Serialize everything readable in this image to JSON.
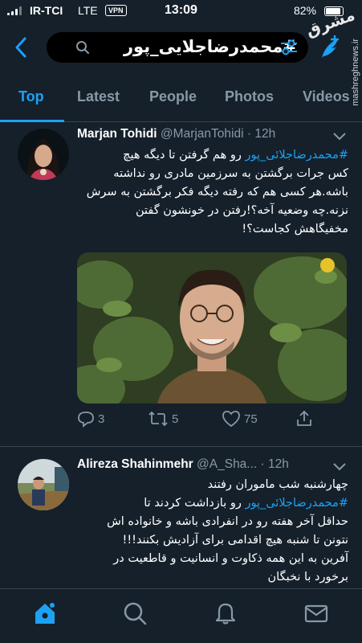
{
  "status_bar": {
    "carrier": "IR-TCI",
    "network": "LTE",
    "vpn": "VPN",
    "time": "13:09",
    "battery": "82%",
    "battery_level": 0.82
  },
  "watermark": {
    "logo": "مشرق",
    "text": "mashreghnews.ir"
  },
  "search": {
    "query": "#محمدرضاجلایی_پور"
  },
  "tabs": [
    {
      "label": "Top",
      "active": true
    },
    {
      "label": "Latest",
      "active": false
    },
    {
      "label": "People",
      "active": false
    },
    {
      "label": "Photos",
      "active": false
    },
    {
      "label": "Videos",
      "active": false
    }
  ],
  "tweets": [
    {
      "name": "Marjan Tohidi",
      "handle": "@MarjanTohidi",
      "time": "· 12h",
      "lines": [
        {
          "hashtag": "#محمدرضاجلائی_پور",
          "text": " رو هم گرفتن تا دیگه هیچ"
        },
        {
          "text": "کس جرات برگشتن به سرزمین مادری رو نداشته"
        },
        {
          "text": "باشه.هر کسی هم که رفته دیگه فکر برگشتن به سرش"
        },
        {
          "text": "نزنه.چه وضعیه آخه؟!رفتن در خونشون گفتن"
        },
        {
          "text": "مخفیگاهش کجاست؟!"
        }
      ],
      "replies": "3",
      "retweets": "5",
      "likes": "75"
    },
    {
      "name": "Alireza Shahinmehr",
      "handle": "@A_Sha...",
      "time": "· 12h",
      "lines": [
        {
          "text": "چهارشنبه شب ماموران رفتند"
        },
        {
          "hashtag": "#محمدرضاجلائی_پور",
          "text": " رو بازداشت کردند تا"
        },
        {
          "text": "حداقل آخر هفته رو در انفرادی باشه و خانواده اش"
        },
        {
          "text": "نتونن تا شنبه هیچ اقدامی برای آزادیش بکنند!!!"
        },
        {
          "text": "آفرین به این همه ذکاوت و انسانیت و قاطعیت در"
        },
        {
          "text": "برخورد با نخبگان"
        }
      ]
    }
  ],
  "colors": {
    "background": "#15202b",
    "accent": "#1da1f2",
    "muted": "#8899a6",
    "divider": "#38444d"
  },
  "icons": [
    "back-arrow-icon",
    "search-icon",
    "filter-icon",
    "compose-icon",
    "reply-icon",
    "retweet-icon",
    "like-icon",
    "share-icon",
    "home-icon",
    "explore-icon",
    "notifications-icon",
    "messages-icon",
    "chevron-down-icon"
  ]
}
